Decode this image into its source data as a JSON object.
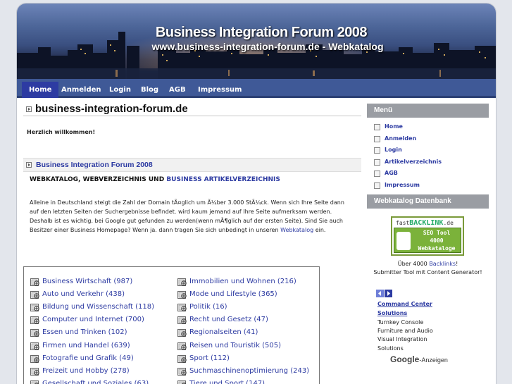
{
  "header": {
    "title": "Business Integration Forum 2008",
    "subtitle": "www.business-integration-forum.de - Webkatalog"
  },
  "nav": {
    "items": [
      {
        "label": "Home"
      },
      {
        "label": "Anmelden"
      },
      {
        "label": "Login"
      },
      {
        "label": "Blog"
      },
      {
        "label": "AGB"
      },
      {
        "label": "Impressum"
      }
    ]
  },
  "main": {
    "title": "business-integration-forum.de",
    "welcome": "Herzlich willkommen!",
    "section_title": "Business Integration Forum 2008",
    "subhead_black": "WEBKATALOG, WEBVERZEICHNIS UND",
    "subhead_blue": "BUSINESS ARTIKELVERZEICHNIS",
    "paragraph_1": "Alleine in Deutschland steigt die Zahl der Domain tÃ¤glich um Ã¼ber 3.000 StÃ¼ck. Wenn sich Ihre Seite dann",
    "paragraph_2": "auf den letzten Seiten der Suchergebnisse befindet. wird kaum jemand auf Ihre Seite aufmerksam werden.",
    "paragraph_3": "Deshalb ist es wichtig. bei Google gut gefunden zu werden(wenn mÃ¶glich auf der ersten Seite). Sind Sie auch",
    "paragraph_4a": "Besitzer einer Business Homepage? Wenn ja. dann tragen Sie sich unbedingt in unseren",
    "paragraph_4_link": "Webkatalog",
    "paragraph_4b": "ein."
  },
  "categories": {
    "left": [
      "Business Wirtschaft (987)",
      "Auto und Verkehr (438)",
      "Bildung und Wissenschaft (118)",
      "Computer und Internet (700)",
      "Essen und Trinken (102)",
      "Firmen und Handel (639)",
      "Fotografie und Grafik (49)",
      "Freizeit und Hobby (278)",
      "Gesellschaft und Soziales (63)"
    ],
    "right": [
      "Immobilien und Wohnen (216)",
      "Mode und Lifestyle (365)",
      "Politik (16)",
      "Recht und Gesetz (47)",
      "Regionalseiten (41)",
      "Reisen und Touristik (505)",
      "Sport (112)",
      "Suchmaschinenoptimierung (243)",
      "Tiere und Sport (147)"
    ]
  },
  "sidebar": {
    "menu_title": "Menü",
    "menu_items": [
      "Home",
      "Anmelden",
      "Login",
      "Artikelverzeichnis",
      "AGB",
      "Impressum"
    ],
    "datenbank_title": "Webkatalog Datenbank",
    "badge_brand_prefix": "fast",
    "badge_brand": "BACKLINK",
    "badge_brand_suffix": ".de",
    "badge_line1": "SEO Tool",
    "badge_line2": "4000",
    "badge_line3": "Webkataloge",
    "promo_prefix": "Über 4000",
    "promo_link": "Backlinks",
    "promo_suffix": "!",
    "promo_line2": "Submitter Tool mit Content Generator!",
    "ad_link_1": "Command Center",
    "ad_link_2": "Solutions",
    "ad_lines": [
      "Turnkey Console",
      "Furniture and Audio",
      "Visual Integration",
      "Solutions"
    ],
    "google_brand": "Google",
    "google_suffix": "-Anzeigen"
  },
  "colors": {
    "nav_bg": "#3f5997",
    "nav_active": "#2d3ba2",
    "link": "#2d3ba2",
    "side_head": "#9a9da3",
    "badge_green": "#7bb23a"
  }
}
